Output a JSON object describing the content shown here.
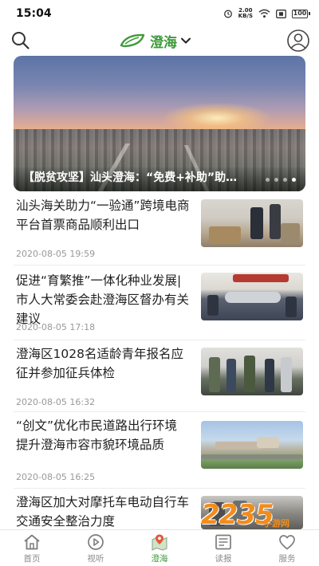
{
  "status_bar": {
    "time": "15:04",
    "net_speed_value": "2.00",
    "net_speed_unit": "KB/S",
    "battery": "100"
  },
  "header": {
    "channel_name": "澄海",
    "icons": [
      "search-icon",
      "leaf-logo-icon",
      "chevron-down-icon",
      "user-icon"
    ],
    "accent_color": "#3f9a3a"
  },
  "banner": {
    "title": "【脱贫攻坚】汕头澄海：“免费+补助”助…",
    "page_count": 4,
    "active_page": 4
  },
  "news": [
    {
      "title": "汕头海关助力“一验通”跨境电商平台首票商品顺利出口",
      "date": "2020-08-05 19:59"
    },
    {
      "title": "促进“育繁推”一体化种业发展|市人大常委会赴澄海区督办有关建议",
      "date": "2020-08-05 17:18"
    },
    {
      "title": "澄海区1028名适龄青年报名应征并参加征兵体检",
      "date": "2020-08-05 16:32"
    },
    {
      "title": "“创文”优化市民道路出行环境 提升澄海市容市貌环境品质",
      "date": "2020-08-05 16:25"
    },
    {
      "title": "澄海区加大对摩托车电动自行车交通安全整治力度",
      "date": ""
    }
  ],
  "bottom_nav": {
    "items": [
      {
        "label": "首页",
        "icon": "home-icon"
      },
      {
        "label": "视听",
        "icon": "play-icon"
      },
      {
        "label": "澄海",
        "icon": "map-pin-icon"
      },
      {
        "label": "读报",
        "icon": "newspaper-icon"
      },
      {
        "label": "服务",
        "icon": "heart-icon"
      }
    ],
    "active_index": 2
  },
  "watermark": {
    "text": "2235",
    "sub": "手游网"
  }
}
